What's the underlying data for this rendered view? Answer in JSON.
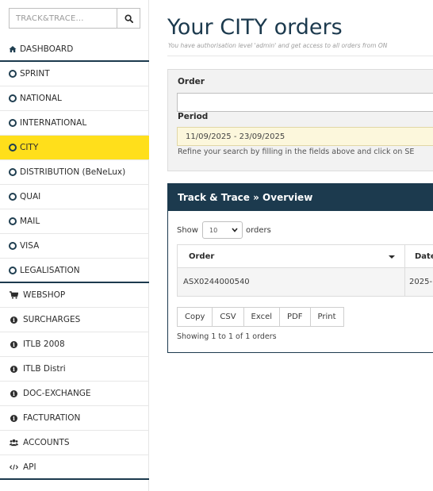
{
  "sidebar": {
    "search": {
      "placeholder": "TRACK&TRACE..."
    },
    "items": [
      {
        "label": "DASHBOARD",
        "icon": "home-icon"
      },
      {
        "label": "SPRINT",
        "icon": "ring-icon"
      },
      {
        "label": "NATIONAL",
        "icon": "ring-icon"
      },
      {
        "label": "INTERNATIONAL",
        "icon": "ring-icon"
      },
      {
        "label": "CITY",
        "icon": "ring-icon",
        "active": true
      },
      {
        "label": "DISTRIBUTION (BeNeLux)",
        "icon": "ring-icon"
      },
      {
        "label": "QUAI",
        "icon": "ring-icon"
      },
      {
        "label": "MAIL",
        "icon": "ring-icon"
      },
      {
        "label": "VISA",
        "icon": "ring-icon"
      },
      {
        "label": "LEGALISATION",
        "icon": "ring-icon"
      },
      {
        "label": "WEBSHOP",
        "icon": "cart-icon"
      },
      {
        "label": "SURCHARGES",
        "icon": "info-icon"
      },
      {
        "label": "ITLB 2008",
        "icon": "info-icon"
      },
      {
        "label": "ITLB Distri",
        "icon": "info-icon"
      },
      {
        "label": "DOC-EXCHANGE",
        "icon": "info-icon"
      },
      {
        "label": "FACTURATION",
        "icon": "info-icon"
      },
      {
        "label": "ACCOUNTS",
        "icon": "users-icon"
      },
      {
        "label": "API",
        "icon": "code-icon"
      }
    ]
  },
  "main": {
    "title": "Your CITY orders",
    "subtitle": "You have authorisation level 'admin' and get access to all orders from ON",
    "filter": {
      "order_label": "Order",
      "order_value": "",
      "period_label": "Period",
      "period_value": "11/09/2025 - 23/09/2025",
      "help": "Refine your search by filling in the fields above and click on SE"
    },
    "track_trace": {
      "title": "Track & Trace » Overview",
      "show_label": "Show",
      "page_length": "10",
      "orders_label": "orders",
      "columns": [
        "Order",
        "Date"
      ],
      "rows": [
        {
          "order": "ASX0244000540",
          "date": "2025-"
        }
      ],
      "buttons": [
        "Copy",
        "CSV",
        "Excel",
        "PDF",
        "Print"
      ],
      "info": "Showing 1 to 1 of 1 orders"
    }
  },
  "colors": {
    "brand_navy": "#1c3a4e",
    "active_yellow": "#ffdf1b",
    "period_bg": "#fcf7dc"
  }
}
